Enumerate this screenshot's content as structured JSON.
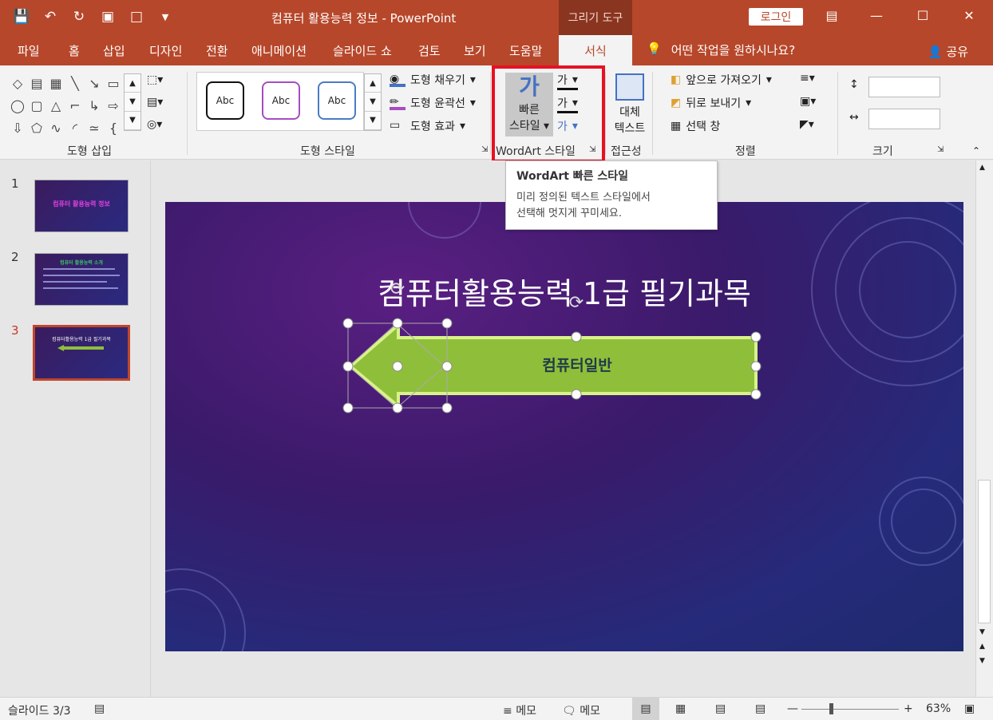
{
  "titlebar": {
    "title": "컴퓨터 활용능력 정보  -  PowerPoint",
    "context_tab": "그리기 도구",
    "login": "로그인"
  },
  "tabs": [
    "파일",
    "홈",
    "삽입",
    "디자인",
    "전환",
    "애니메이션",
    "슬라이드 쇼",
    "검토",
    "보기",
    "도움말",
    "서식"
  ],
  "tell_me": "어떤 작업을 원하시나요?",
  "share": "공유",
  "ribbon": {
    "shape_insert_label": "도형 삽입",
    "shape_styles_label": "도형 스타일",
    "style_sample": "Abc",
    "fill": "도형 채우기",
    "outline": "도형 윤곽선",
    "effects": "도형 효과",
    "quick_style_line1": "빠른",
    "quick_style_line2": "스타일",
    "wordart_glyph": "가",
    "wordart_label": "WordArt 스타일",
    "alt_text_line1": "대체",
    "alt_text_line2": "텍스트",
    "accessibility_label": "접근성",
    "bring_forward": "앞으로 가져오기",
    "send_backward": "뒤로 보내기",
    "selection_pane": "선택 창",
    "arrange_label": "정렬",
    "size_label": "크기"
  },
  "tooltip": {
    "title": "WordArt 빠른 스타일",
    "body_line1": "미리 정의된 텍스트 스타일에서",
    "body_line2": "선택해 멋지게 꾸미세요."
  },
  "thumbnails": [
    {
      "num": "1",
      "text": "컴퓨터 활용능력 정보"
    },
    {
      "num": "2",
      "text": "컴퓨터 활용능력 소개"
    },
    {
      "num": "3",
      "text": "컴퓨터활용능력 1급 필기과목"
    }
  ],
  "slide": {
    "title": "컴퓨터활용능력 1급 필기과목",
    "arrow_text": "컴퓨터일반"
  },
  "status": {
    "slide_info": "슬라이드 3/3",
    "notes": "메모",
    "comments": "메모",
    "zoom": "63%"
  },
  "colors": {
    "accent": "#b7472a",
    "highlight": "#e81123",
    "arrow_fill": "#8fbf3a"
  }
}
